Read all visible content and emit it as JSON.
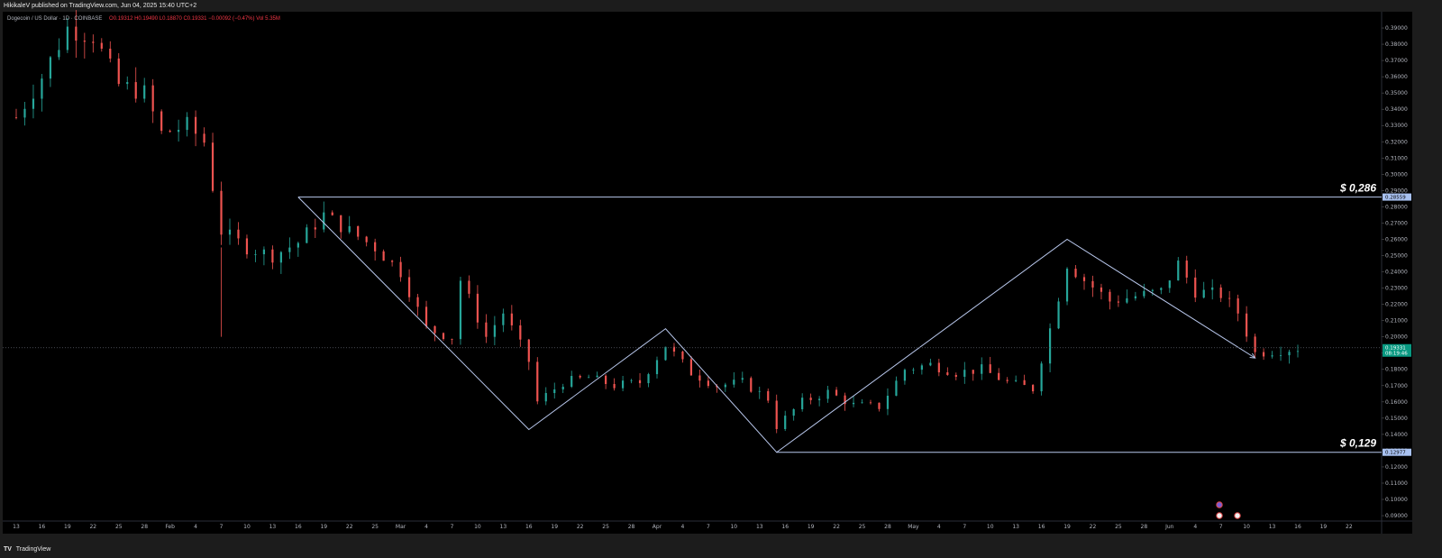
{
  "header": {
    "publisher_line": "HikikaleV published on TradingView.com, Jun 04, 2025 15:40 UTC+2"
  },
  "legend": {
    "symbol": "Dogecoin / US Dollar · 1D · COINBASE",
    "ohlc": "O0.19312  H0.19490  L0.18870  C0.19331  −0.00092 (−0.47%)  Vol 5.35M"
  },
  "footer": {
    "logo_glyph": "TV",
    "brand": "TradingView"
  },
  "colors": {
    "background": "#000000",
    "frame": "#1c1c1c",
    "up_candle": "#26a69a",
    "down_candle": "#ef5350",
    "drawing_line": "#b8c7ec",
    "price_line": "#5d606b",
    "last_price_tag": "#089981"
  },
  "chart_data": {
    "type": "candlestick",
    "title": "",
    "y_axis": {
      "side": "right",
      "ylim": [
        0.0867,
        0.4
      ],
      "ticks": [
        "0.39000",
        "0.38000",
        "0.37000",
        "0.36000",
        "0.35000",
        "0.34000",
        "0.33000",
        "0.32000",
        "0.31000",
        "0.30000",
        "0.29000",
        "0.28000",
        "0.27000",
        "0.26000",
        "0.25000",
        "0.24000",
        "0.23000",
        "0.22000",
        "0.21000",
        "0.20000",
        "0.19000",
        "0.18000",
        "0.17000",
        "0.16000",
        "0.15000",
        "0.14000",
        "0.13000",
        "0.12000",
        "0.11000",
        "0.10000",
        "0.09000"
      ],
      "tick_values": [
        0.39,
        0.38,
        0.37,
        0.36,
        0.35,
        0.34,
        0.33,
        0.32,
        0.31,
        0.3,
        0.29,
        0.28,
        0.27,
        0.26,
        0.25,
        0.24,
        0.23,
        0.22,
        0.21,
        0.2,
        0.19,
        0.18,
        0.17,
        0.16,
        0.15,
        0.14,
        0.13,
        0.12,
        0.11,
        0.1,
        0.09
      ]
    },
    "x_axis": {
      "labels": [
        "13",
        "16",
        "19",
        "22",
        "25",
        "28",
        "Feb",
        "4",
        "7",
        "10",
        "13",
        "16",
        "19",
        "22",
        "25",
        "Mar",
        "4",
        "7",
        "10",
        "13",
        "16",
        "19",
        "22",
        "25",
        "28",
        "Apr",
        "4",
        "7",
        "10",
        "13",
        "16",
        "19",
        "22",
        "25",
        "28",
        "May",
        "4",
        "7",
        "10",
        "13",
        "16",
        "19",
        "22",
        "25",
        "28",
        "Jun",
        "4",
        "7",
        "10",
        "13",
        "16",
        "19",
        "22"
      ],
      "start_day": 0,
      "day_spacing": 3
    },
    "key_points": [
      {
        "day": 0,
        "close": 0.335
      },
      {
        "day": 3,
        "close": 0.36
      },
      {
        "day": 6,
        "close": 0.39
      },
      {
        "day": 9,
        "close": 0.385
      },
      {
        "day": 12,
        "close": 0.355
      },
      {
        "day": 15,
        "close": 0.35
      },
      {
        "day": 17,
        "close": 0.325
      },
      {
        "day": 20,
        "close": 0.33
      },
      {
        "day": 22,
        "close": 0.32
      },
      {
        "day": 24,
        "close": 0.265
      },
      {
        "day": 27,
        "close": 0.255
      },
      {
        "day": 30,
        "close": 0.25
      },
      {
        "day": 33,
        "close": 0.258
      },
      {
        "day": 36,
        "close": 0.275
      },
      {
        "day": 39,
        "close": 0.265
      },
      {
        "day": 42,
        "close": 0.255
      },
      {
        "day": 45,
        "close": 0.24
      },
      {
        "day": 48,
        "close": 0.205
      },
      {
        "day": 51,
        "close": 0.2
      },
      {
        "day": 52,
        "close": 0.235
      },
      {
        "day": 55,
        "close": 0.2
      },
      {
        "day": 57,
        "close": 0.215
      },
      {
        "day": 60,
        "close": 0.185
      },
      {
        "day": 61,
        "close": 0.16
      },
      {
        "day": 64,
        "close": 0.172
      },
      {
        "day": 67,
        "close": 0.175
      },
      {
        "day": 70,
        "close": 0.17
      },
      {
        "day": 73,
        "close": 0.172
      },
      {
        "day": 76,
        "close": 0.195
      },
      {
        "day": 79,
        "close": 0.178
      },
      {
        "day": 82,
        "close": 0.17
      },
      {
        "day": 85,
        "close": 0.172
      },
      {
        "day": 88,
        "close": 0.162
      },
      {
        "day": 89,
        "close": 0.145
      },
      {
        "day": 92,
        "close": 0.16
      },
      {
        "day": 95,
        "close": 0.166
      },
      {
        "day": 98,
        "close": 0.158
      },
      {
        "day": 101,
        "close": 0.157
      },
      {
        "day": 104,
        "close": 0.18
      },
      {
        "day": 107,
        "close": 0.183
      },
      {
        "day": 110,
        "close": 0.178
      },
      {
        "day": 113,
        "close": 0.18
      },
      {
        "day": 116,
        "close": 0.172
      },
      {
        "day": 119,
        "close": 0.168
      },
      {
        "day": 121,
        "close": 0.205
      },
      {
        "day": 123,
        "close": 0.245
      },
      {
        "day": 125,
        "close": 0.235
      },
      {
        "day": 128,
        "close": 0.222
      },
      {
        "day": 131,
        "close": 0.225
      },
      {
        "day": 134,
        "close": 0.228
      },
      {
        "day": 136,
        "close": 0.245
      },
      {
        "day": 138,
        "close": 0.228
      },
      {
        "day": 141,
        "close": 0.226
      },
      {
        "day": 143,
        "close": 0.215
      },
      {
        "day": 145,
        "close": 0.19
      },
      {
        "day": 148,
        "close": 0.192
      },
      {
        "day": 150,
        "close": 0.193
      }
    ],
    "annotations": {
      "resistance": {
        "price": 0.286,
        "label": "$ 0,286",
        "axis_tag": "0.28559",
        "from_day": 33
      },
      "support": {
        "price": 0.129,
        "label": "$ 0,129",
        "axis_tag": "0.12977",
        "from_day": 89
      },
      "zigzag": [
        {
          "day": 33,
          "price": 0.286
        },
        {
          "day": 60,
          "price": 0.143
        },
        {
          "day": 76,
          "price": 0.205
        },
        {
          "day": 89,
          "price": 0.129
        },
        {
          "day": 123,
          "price": 0.26
        },
        {
          "day": 145,
          "price": 0.187
        }
      ],
      "last_price": {
        "price": 0.19331,
        "label": "0.19331",
        "countdown": "08:19:46"
      }
    }
  }
}
